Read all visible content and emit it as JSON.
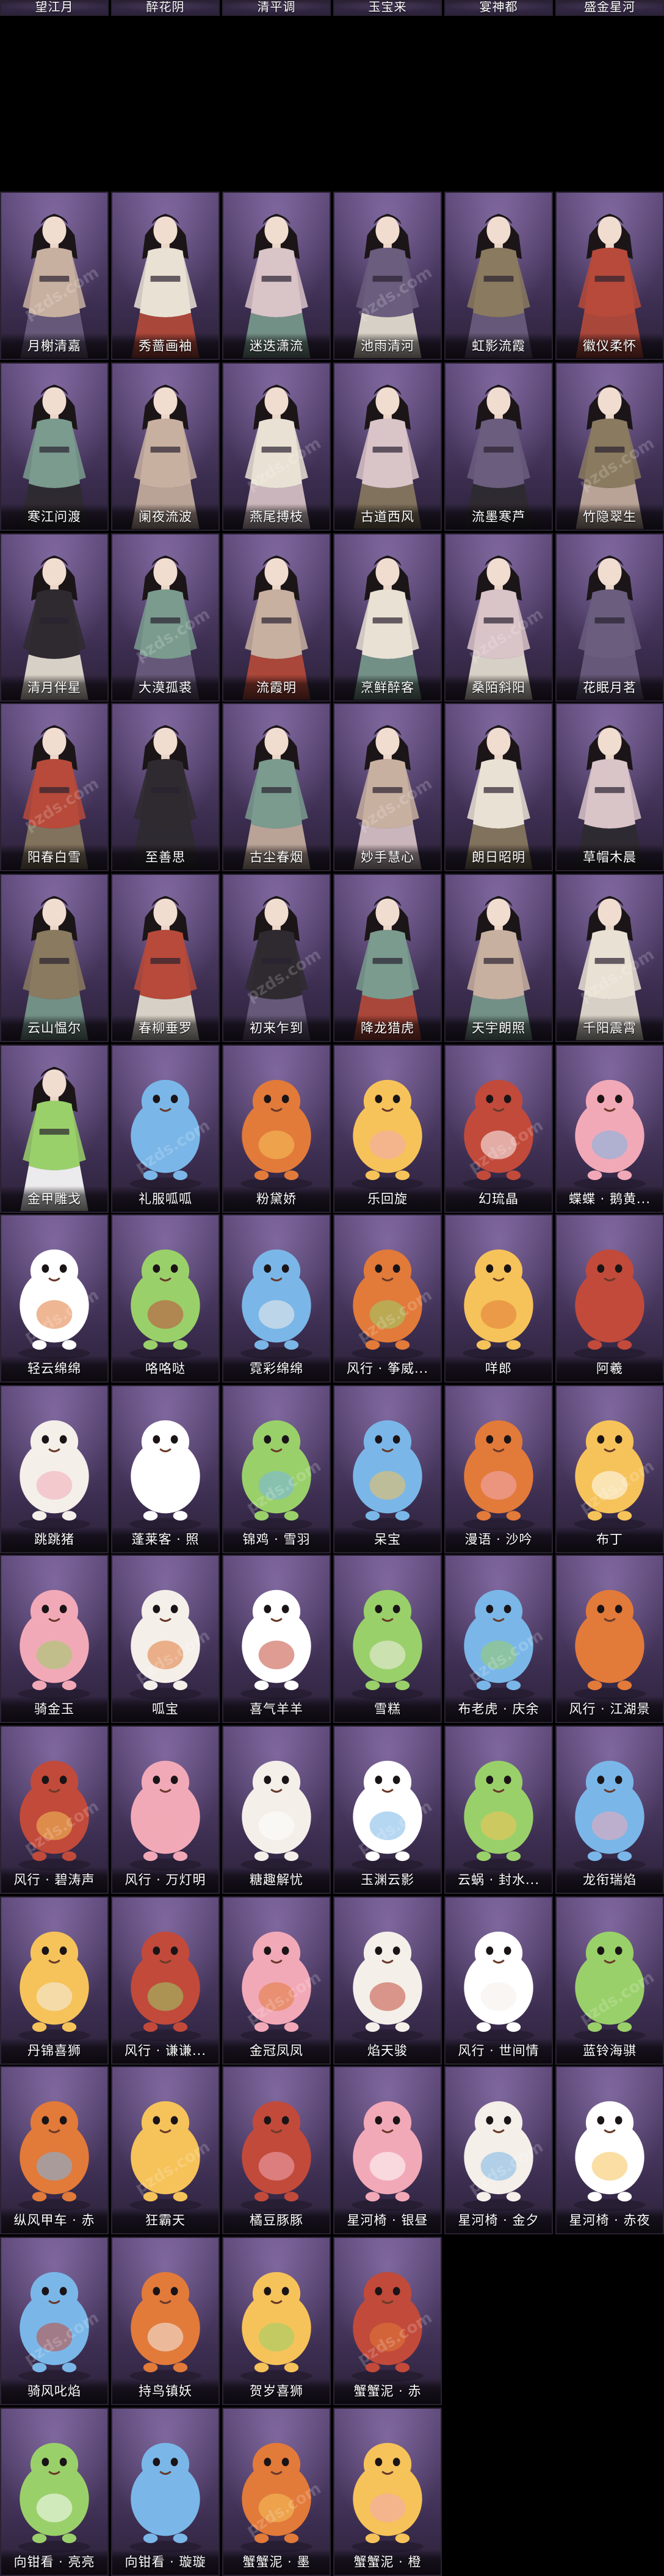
{
  "watermark": "pzds.com",
  "rows": [
    {
      "kind": "costume",
      "labels": [
        "望江月",
        "醉花阴",
        "清平调",
        "玉宝来",
        "宴神都",
        "盛金星河"
      ]
    },
    {
      "kind": "costume",
      "labels": [
        "月榭清嘉",
        "秀蔷画袖",
        "迷迭潇流",
        "池雨清河",
        "虹影流霞",
        "徽仪柔怀"
      ]
    },
    {
      "kind": "costume",
      "labels": [
        "寒江问渡",
        "阑夜流波",
        "燕尾搏枝",
        "古道西风",
        "流墨寒芦",
        "竹隐翠生"
      ]
    },
    {
      "kind": "costume",
      "labels": [
        "清月伴星",
        "大漠孤裘",
        "流霞明",
        "烹鲜醉客",
        "桑陌斜阳",
        "花眠月茗"
      ]
    },
    {
      "kind": "costume",
      "labels": [
        "阳春白雪",
        "至善思",
        "古尘春烟",
        "妙手慧心",
        "朗日昭明",
        "草帽木晨"
      ]
    },
    {
      "kind": "costume",
      "labels": [
        "云山愠尔",
        "春柳垂罗",
        "初来乍到",
        "降龙猎虎",
        "天宇朗照",
        "千阳震霄"
      ]
    },
    {
      "kind": "mixed",
      "labels": [
        "金甲雕戈",
        "礼服呱呱",
        "粉黛娇",
        "乐回旋",
        "幻琉晶",
        "蝶蝶 · 鹅黄..."
      ]
    },
    {
      "kind": "pet",
      "labels": [
        "轻云绵绵",
        "咯咯哒",
        "霓彩绵绵",
        "风行 · 筝威...",
        "咩郎",
        "阿羲"
      ]
    },
    {
      "kind": "pet",
      "labels": [
        "跳跳猪",
        "蓬莱客 · 照",
        "锦鸡 · 雪羽",
        "呆宝",
        "漫语 · 沙吟",
        "布丁"
      ]
    },
    {
      "kind": "pet",
      "labels": [
        "骑金玉",
        "呱宝",
        "喜气羊羊",
        "雪糕",
        "布老虎 · 庆余",
        "风行 · 江湖景"
      ]
    },
    {
      "kind": "pet",
      "labels": [
        "风行 · 碧涛声",
        "风行 · 万灯明",
        "糖趣解忧",
        "玉渊云影",
        "云蜗 · 封水...",
        "龙衔瑞焰"
      ]
    },
    {
      "kind": "pet",
      "labels": [
        "丹锦喜狮",
        "风行 · 谦谦...",
        "金冠凤凤",
        "焰天骏",
        "风行 · 世间情",
        "蓝铃海骐"
      ]
    },
    {
      "kind": "pet",
      "labels": [
        "纵风甲车 · 赤",
        "狂霸天",
        "橘豆豚豚",
        "星河椅 · 银昼",
        "星河椅 · 金夕",
        "星河椅 · 赤夜"
      ]
    },
    {
      "kind": "pet",
      "labels": [
        "骑风叱焰",
        "持鸟镇妖",
        "贺岁喜狮",
        "蟹蟹泥 · 赤",
        "",
        ""
      ]
    },
    {
      "kind": "pet",
      "labels": [
        "向钳看 · 亮亮",
        "向钳看 · 璇璇",
        "蟹蟹泥 · 墨",
        "蟹蟹泥 · 橙",
        "",
        ""
      ]
    },
    {
      "kind": "pet",
      "labels": [
        "",
        "",
        "",
        "",
        "",
        ""
      ]
    }
  ]
}
